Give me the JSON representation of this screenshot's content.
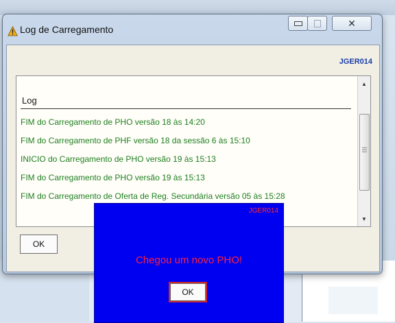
{
  "window": {
    "title": "Log de Carregamento",
    "code": "JGER014"
  },
  "log": {
    "header": "Log",
    "lines": [
      "FIM do Carregamento de PHO versão  18  às 14:20",
      "FIM do Carregamento de PHF versão  18  da sessão  6  às 15:10",
      "INICIO do Carregamento de PHO versão  19  às 15:13",
      "FIM do Carregamento de PHO versão  19  às 15:13",
      "FIM do Carregamento de Oferta de Reg. Secundária versão  05  às 15:28"
    ]
  },
  "main_ok_label": "OK",
  "popup": {
    "code": "JGER014",
    "message": "Chegou um novo PHO!",
    "ok_label": "OK"
  },
  "colors": {
    "log_text": "#1e7f1e",
    "popup_background": "#0000f0",
    "popup_text": "#ff1f3d",
    "code_text": "#1b3fa8"
  },
  "icons": [
    "warning-icon",
    "minimize-icon",
    "maximize-icon",
    "close-icon",
    "scroll-up-icon",
    "scroll-down-icon"
  ]
}
